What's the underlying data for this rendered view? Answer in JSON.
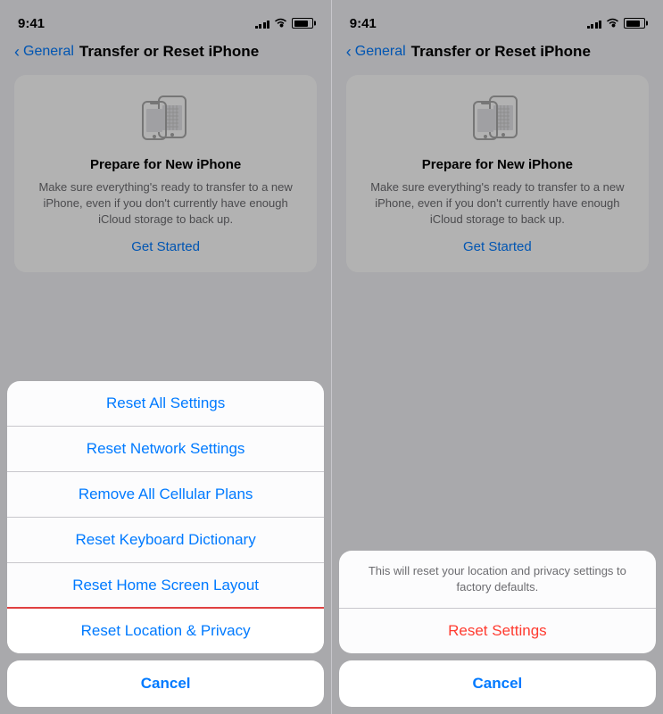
{
  "left_panel": {
    "status": {
      "time": "9:41"
    },
    "nav": {
      "back_label": "General",
      "title": "Transfer or Reset iPhone"
    },
    "prepare_card": {
      "title": "Prepare for New iPhone",
      "description": "Make sure everything's ready to transfer to a new iPhone, even if you don't currently have enough iCloud storage to back up.",
      "get_started": "Get Started"
    },
    "reset_sheet": {
      "options": [
        {
          "id": "reset-all-settings",
          "label": "Reset All Settings"
        },
        {
          "id": "reset-network-settings",
          "label": "Reset Network Settings"
        },
        {
          "id": "remove-cellular-plans",
          "label": "Remove All Cellular Plans"
        },
        {
          "id": "reset-keyboard-dictionary",
          "label": "Reset Keyboard Dictionary"
        },
        {
          "id": "reset-home-screen-layout",
          "label": "Reset Home Screen Layout"
        },
        {
          "id": "reset-location-privacy",
          "label": "Reset Location & Privacy",
          "highlighted": true
        }
      ],
      "cancel_label": "Cancel"
    }
  },
  "right_panel": {
    "status": {
      "time": "9:41"
    },
    "nav": {
      "back_label": "General",
      "title": "Transfer or Reset iPhone"
    },
    "prepare_card": {
      "title": "Prepare for New iPhone",
      "description": "Make sure everything's ready to transfer to a new iPhone, even if you don't currently have enough iCloud storage to back up.",
      "get_started": "Get Started"
    },
    "confirm_sheet": {
      "message": "This will reset your location and privacy settings to factory defaults.",
      "reset_label": "Reset Settings",
      "cancel_label": "Cancel"
    }
  },
  "icons": {
    "chevron": "‹",
    "wifi": "wifi",
    "battery": "battery"
  }
}
